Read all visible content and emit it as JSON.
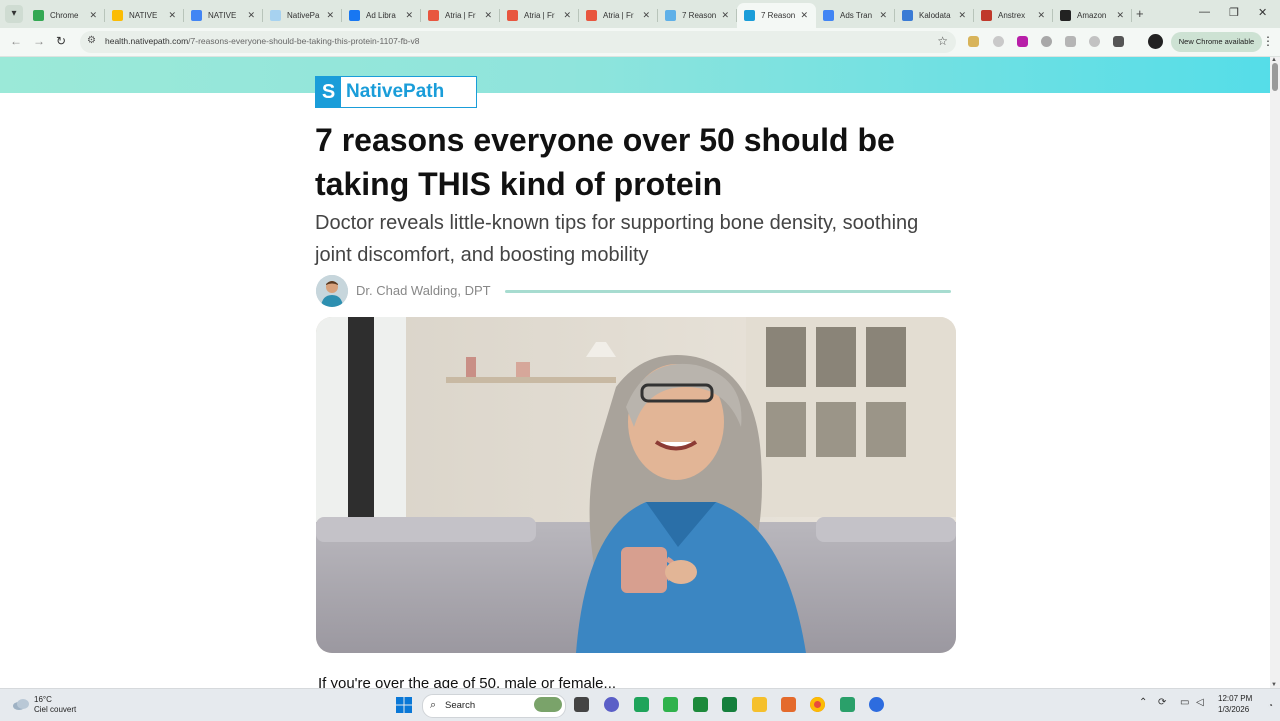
{
  "browser": {
    "tabs": [
      {
        "label": "Chrome",
        "fav_color": "#34a853",
        "active": false
      },
      {
        "label": "NATIVE",
        "fav_color": "#fbbc05",
        "active": false
      },
      {
        "label": "NATIVE",
        "fav_color": "#4285f4",
        "active": false
      },
      {
        "label": "NativePa",
        "fav_color": "#a7d2f0",
        "active": false
      },
      {
        "label": "Ad Libra",
        "fav_color": "#1877f2",
        "active": false
      },
      {
        "label": "Atria | Fr",
        "fav_color": "#e8563f",
        "active": false
      },
      {
        "label": "Atria | Fr",
        "fav_color": "#e8563f",
        "active": false
      },
      {
        "label": "Atria | Fr",
        "fav_color": "#e8563f",
        "active": false
      },
      {
        "label": "7 Reason",
        "fav_color": "#5fb0e8",
        "active": false
      },
      {
        "label": "7 Reason",
        "fav_color": "#1a9dd9",
        "active": true
      },
      {
        "label": "Ads Tran",
        "fav_color": "#4285f4",
        "active": false
      },
      {
        "label": "Kalodata",
        "fav_color": "#3a7bd5",
        "active": false
      },
      {
        "label": "Anstrex",
        "fav_color": "#c0392b",
        "active": false
      },
      {
        "label": "Amazon",
        "fav_color": "#222222",
        "active": false
      }
    ],
    "url_host": "health.nativepath.com",
    "url_path": "/7-reasons-everyone-should-be-taking-this-protein-1107-fb-v8",
    "new_chrome_label": "New Chrome available"
  },
  "page": {
    "logo_text": "NativePath",
    "headline": "7 reasons everyone over 50 should be taking THIS kind of protein",
    "subheadline": "Doctor reveals little-known tips for supporting bone density, soothing joint discomfort, and boosting mobility",
    "author": "Dr. Chad Walding, DPT",
    "body_first_line": "If you're over the age of 50, male or female..."
  },
  "taskbar": {
    "temperature": "16°C",
    "condition": "Ciel couvert",
    "search_label": "Search",
    "time": "12:07 PM",
    "date": "1/3/2026"
  },
  "colors": {
    "brand_blue": "#1a9dd9",
    "banner_start": "#9be9d8",
    "banner_end": "#55dde8",
    "accent_rule": "#a7dcd0"
  }
}
